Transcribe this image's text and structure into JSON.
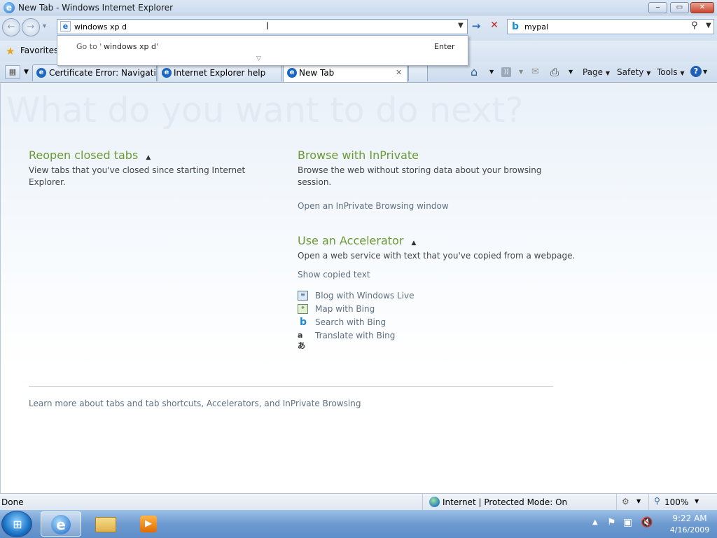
{
  "window": {
    "title": "New Tab - Windows Internet Explorer",
    "minimize": "‒",
    "maximize": "▭",
    "close": "✕"
  },
  "nav": {
    "back": "←",
    "forward": "→",
    "dropdown": "▾",
    "address_value": "windows xp d",
    "go": "→",
    "stop": "✕",
    "search_value": "mypal"
  },
  "autocomplete": {
    "goto_prefix": "Go to '",
    "goto_query": "windows xp d",
    "goto_suffix": "'",
    "enter": "Enter"
  },
  "favorites": {
    "label": "Favorites"
  },
  "tabs": [
    {
      "label": "Certificate Error: Navigatio..."
    },
    {
      "label": "Internet Explorer help"
    },
    {
      "label": "New Tab",
      "close": "✕"
    }
  ],
  "commands": {
    "page": "Page",
    "safety": "Safety",
    "tools": "Tools",
    "help": "?"
  },
  "content": {
    "hero": "What do you want to do next?",
    "reopen": {
      "title": "Reopen closed tabs",
      "desc": "View tabs that you've closed since starting Internet Explorer."
    },
    "inprivate": {
      "title": "Browse with InPrivate",
      "desc": "Browse the web without storing data about your browsing session.",
      "link": "Open an InPrivate Browsing window"
    },
    "accelerator": {
      "title": "Use an Accelerator",
      "desc": "Open a web service with text that you've copied from a webpage.",
      "link": "Show copied text",
      "items": [
        {
          "label": "Blog with Windows Live",
          "icon": "blog-icon"
        },
        {
          "label": "Map with Bing",
          "icon": "map-icon"
        },
        {
          "label": "Search with Bing",
          "icon": "bing-icon"
        },
        {
          "label": "Translate with Bing",
          "icon": "translate-icon"
        }
      ]
    },
    "learn_more": "Learn more about tabs and tab shortcuts, Accelerators, and InPrivate Browsing"
  },
  "status": {
    "text": "Done",
    "zone": "Internet | Protected Mode: On",
    "zoom": "100%"
  },
  "tray": {
    "time": "9:22 AM",
    "date": "4/16/2009"
  },
  "colors": {
    "accent_green": "#6a9a35",
    "link_gray": "#5e6f80",
    "hero": "#e1e9f2",
    "taskbar": "#6d9ad0"
  }
}
